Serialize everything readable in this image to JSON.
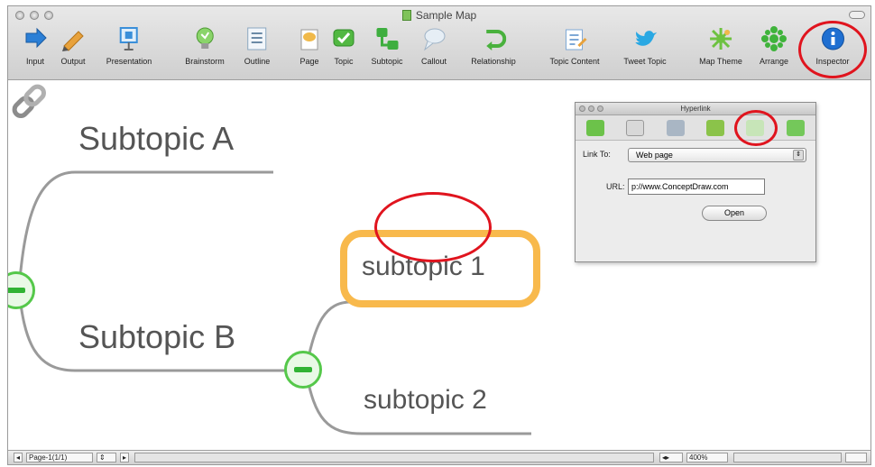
{
  "window": {
    "title": "Sample Map"
  },
  "toolbar": {
    "items": [
      {
        "label": "Input",
        "icon": "input-arrow-icon",
        "color": "#2b7fd6"
      },
      {
        "label": "Output",
        "icon": "output-pencil-icon",
        "color": "#e8a23c"
      },
      {
        "label": "Presentation",
        "icon": "presentation-board-icon",
        "color": "#3a8fd9"
      },
      {
        "label": "Brainstorm",
        "icon": "brainstorm-bulb-icon",
        "color": "#6cc24a"
      },
      {
        "label": "Outline",
        "icon": "outline-list-icon",
        "color": "#8aa7c0"
      },
      {
        "label": "Page",
        "icon": "page-icon",
        "color": "#f0b94a"
      },
      {
        "label": "Topic",
        "icon": "topic-icon",
        "color": "#52b842"
      },
      {
        "label": "Subtopic",
        "icon": "subtopic-icon",
        "color": "#3eae3f"
      },
      {
        "label": "Callout",
        "icon": "callout-icon",
        "color": "#c9d7e3"
      },
      {
        "label": "Relationship",
        "icon": "relationship-icon",
        "color": "#49b13d"
      },
      {
        "label": "Topic Content",
        "icon": "topic-content-icon",
        "color": "#7ea8d6"
      },
      {
        "label": "Tweet Topic",
        "icon": "tweet-bird-icon",
        "color": "#2aa8e3"
      },
      {
        "label": "Map Theme",
        "icon": "map-theme-icon",
        "color": "#6dc240"
      },
      {
        "label": "Arrange",
        "icon": "arrange-icon",
        "color": "#3fb33b"
      },
      {
        "label": "Inspector",
        "icon": "inspector-info-icon",
        "color": "#1f6fd1"
      }
    ]
  },
  "map": {
    "subtopic_a": "Subtopic A",
    "subtopic_b": "Subtopic B",
    "subtopic_1": "subtopic 1",
    "subtopic_2": "subtopic 2"
  },
  "hyperlink_panel": {
    "title": "Hyperlink",
    "link_to_label": "Link To:",
    "link_to_value": "Web page",
    "url_label": "URL:",
    "url_value": "p://www.ConceptDraw.com",
    "open_button": "Open"
  },
  "statusbar": {
    "page_label": "Page-1(1/1)",
    "zoom": "400%"
  },
  "colors": {
    "annotation_ring": "#e0141e",
    "selection": "#f8b94c",
    "collapse": "#55c84a",
    "branch": "#9a9a9a"
  }
}
